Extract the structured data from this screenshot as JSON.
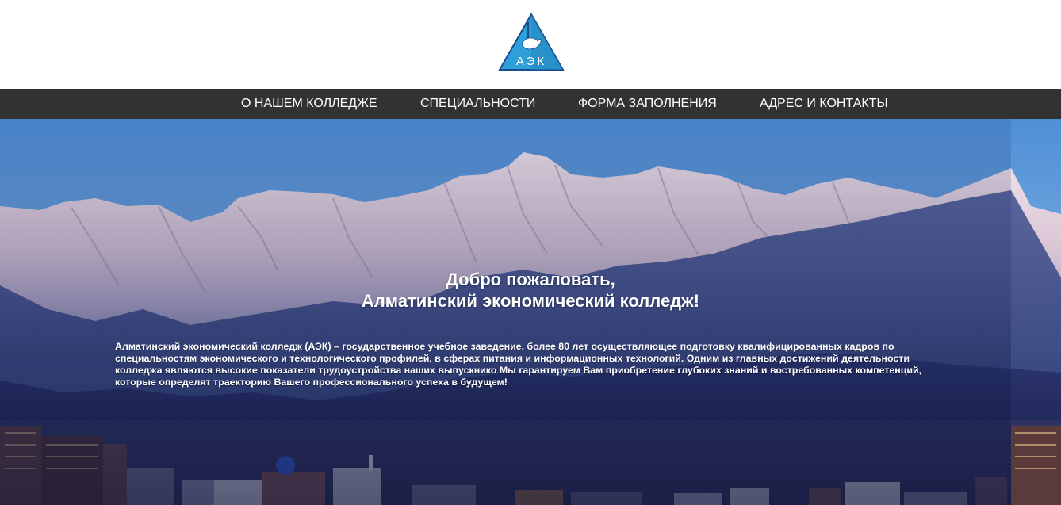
{
  "logo": {
    "text": "АЭК",
    "colors": {
      "triangle": "#2e9fd8",
      "outline": "#1a4b8c",
      "emblem": "#ffffff"
    }
  },
  "nav": {
    "items": [
      {
        "label": "О НАШЕМ КОЛЛЕДЖЕ"
      },
      {
        "label": "СПЕЦИАЛЬНОСТИ"
      },
      {
        "label": "ФОРМА ЗАПОЛНЕНИЯ"
      },
      {
        "label": "АДРЕС И КОНТАКТЫ"
      }
    ],
    "background": "#323232",
    "text_color": "#ffffff"
  },
  "hero": {
    "title_line1": "Добро пожаловать,",
    "title_line2": "Алматинский экономический колледж!",
    "intro": "Алматинский экономический колледж (АЭК) – государственное учебное заведение, более 80 лет осуществляющее подготовку квалифицированных кадров по специальностям экономического и технологического профилей, в сферах питания и информационных технологий. Одним из главных достижений деятельности колледжа являются высокие показатели трудоустройства наших выпускнико Мы гарантируем Вам приобретение глубоких знаний и востребованных компетенций, которые определят траекторию Вашего профессионального успеха в будущем!",
    "image": "mountain-city-panorama"
  }
}
